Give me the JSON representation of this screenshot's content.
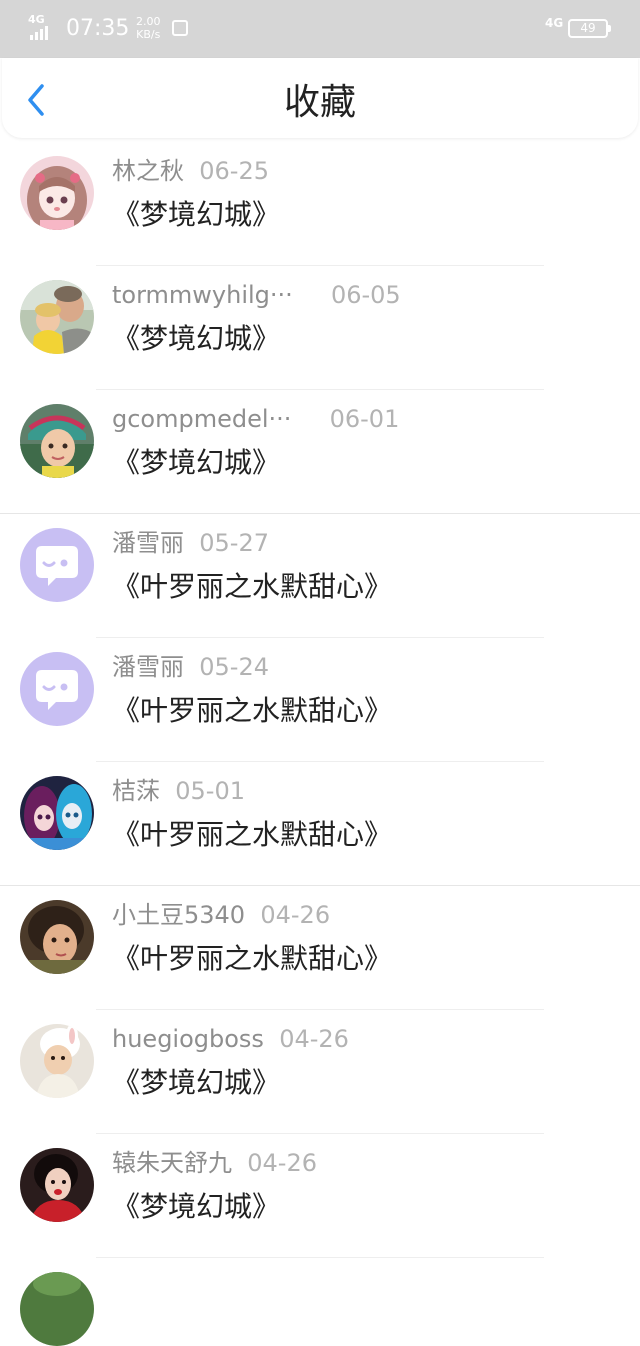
{
  "status_bar": {
    "network_label": "4G",
    "time": "07:35",
    "speed_value": "2.00",
    "speed_unit": "KB/s",
    "secondary_network": "4G",
    "battery": "49"
  },
  "header": {
    "back_icon": "chevron-left-icon",
    "title": "收藏"
  },
  "colors": {
    "accent": "#2f8ff0",
    "status_bar_bg": "#d6d6d6",
    "name_gray": "#8e8e8e",
    "date_gray": "#b3b3b3",
    "text_dark": "#222222",
    "default_avatar_bg": "#c8bff3"
  },
  "favorites": [
    {
      "name": "林之秋",
      "date": "06-25",
      "book": "《梦境幻城》",
      "avatar": "anime-girl-avatar"
    },
    {
      "name": "tormmwyhilg···",
      "date": "06-05",
      "book": "《梦境幻城》",
      "avatar": "photo-avatar"
    },
    {
      "name": "gcompmedel···",
      "date": "06-01",
      "book": "《梦境幻城》",
      "avatar": "photo-avatar"
    },
    {
      "name": "潘雪丽",
      "date": "05-27",
      "book": "《叶罗丽之水默甜心》",
      "avatar": "default-chat-avatar"
    },
    {
      "name": "潘雪丽",
      "date": "05-24",
      "book": "《叶罗丽之水默甜心》",
      "avatar": "default-chat-avatar"
    },
    {
      "name": "桔莯",
      "date": "05-01",
      "book": "《叶罗丽之水默甜心》",
      "avatar": "doll-avatar"
    },
    {
      "name": "小土豆5340",
      "date": "04-26",
      "book": "《叶罗丽之水默甜心》",
      "avatar": "photo-avatar"
    },
    {
      "name": "huegiogboss",
      "date": "04-26",
      "book": "《梦境幻城》",
      "avatar": "photo-avatar"
    },
    {
      "name": "辕朱天舒九",
      "date": "04-26",
      "book": "《梦境幻城》",
      "avatar": "photo-avatar"
    }
  ]
}
